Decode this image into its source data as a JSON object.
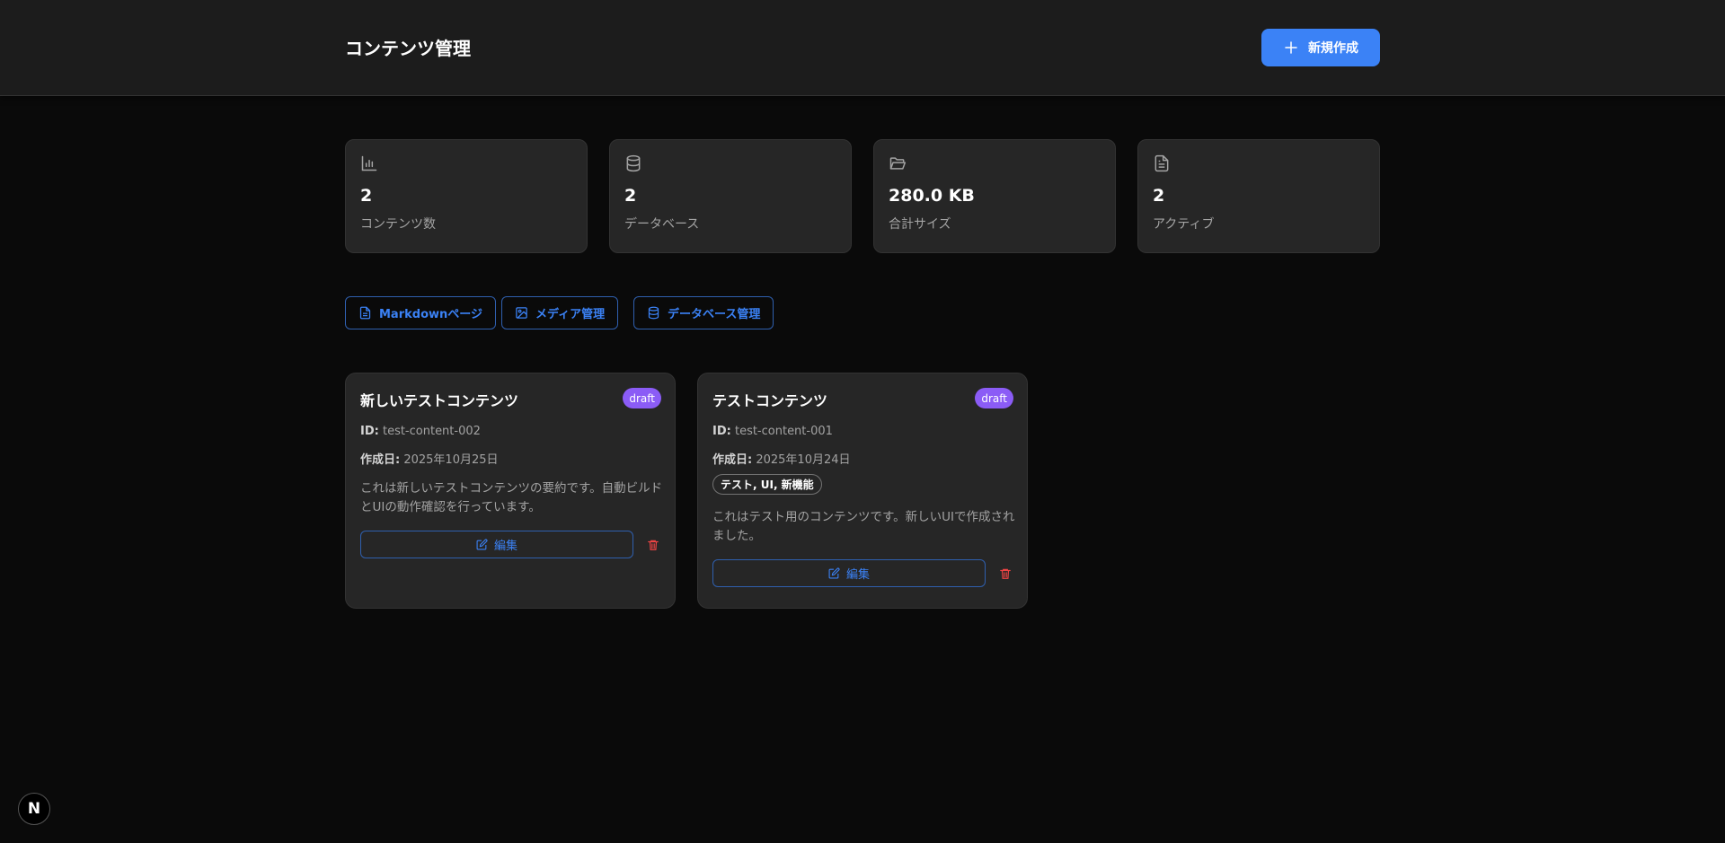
{
  "header": {
    "title": "コンテンツ管理",
    "new_button_label": "新規作成"
  },
  "stats": [
    {
      "icon": "bar-chart-icon",
      "value": "2",
      "label": "コンテンツ数"
    },
    {
      "icon": "database-icon",
      "value": "2",
      "label": "データベース"
    },
    {
      "icon": "folder-open-icon",
      "value": "280.0 KB",
      "label": "合計サイズ"
    },
    {
      "icon": "file-text-icon",
      "value": "2",
      "label": "アクティブ"
    }
  ],
  "nav_links": [
    {
      "icon": "file-text-icon",
      "label": "Markdownページ"
    },
    {
      "icon": "image-icon",
      "label": "メディア管理"
    },
    {
      "icon": "database-icon",
      "label": "データベース管理"
    }
  ],
  "cards": [
    {
      "title": "新しいテストコンテンツ",
      "status": "draft",
      "id_label": "ID:",
      "id": "test-content-002",
      "created_label": "作成日:",
      "created": "2025年10月25日",
      "tags": "",
      "summary": "これは新しいテストコンテンツの要約です。自動ビルドとUIの動作確認を行っています。",
      "edit_label": "編集"
    },
    {
      "title": "テストコンテンツ",
      "status": "draft",
      "id_label": "ID:",
      "id": "test-content-001",
      "created_label": "作成日:",
      "created": "2025年10月24日",
      "tags": "テスト, UI, 新機能",
      "summary": "これはテスト用のコンテンツです。新しいUIで作成されました。",
      "edit_label": "編集"
    }
  ],
  "dev_badge": "N",
  "colors": {
    "accent": "#3b82f6",
    "badge": "#8b5cf6",
    "danger": "#ef4444",
    "card_bg": "#262626",
    "page_bg": "#0a0a0a"
  }
}
